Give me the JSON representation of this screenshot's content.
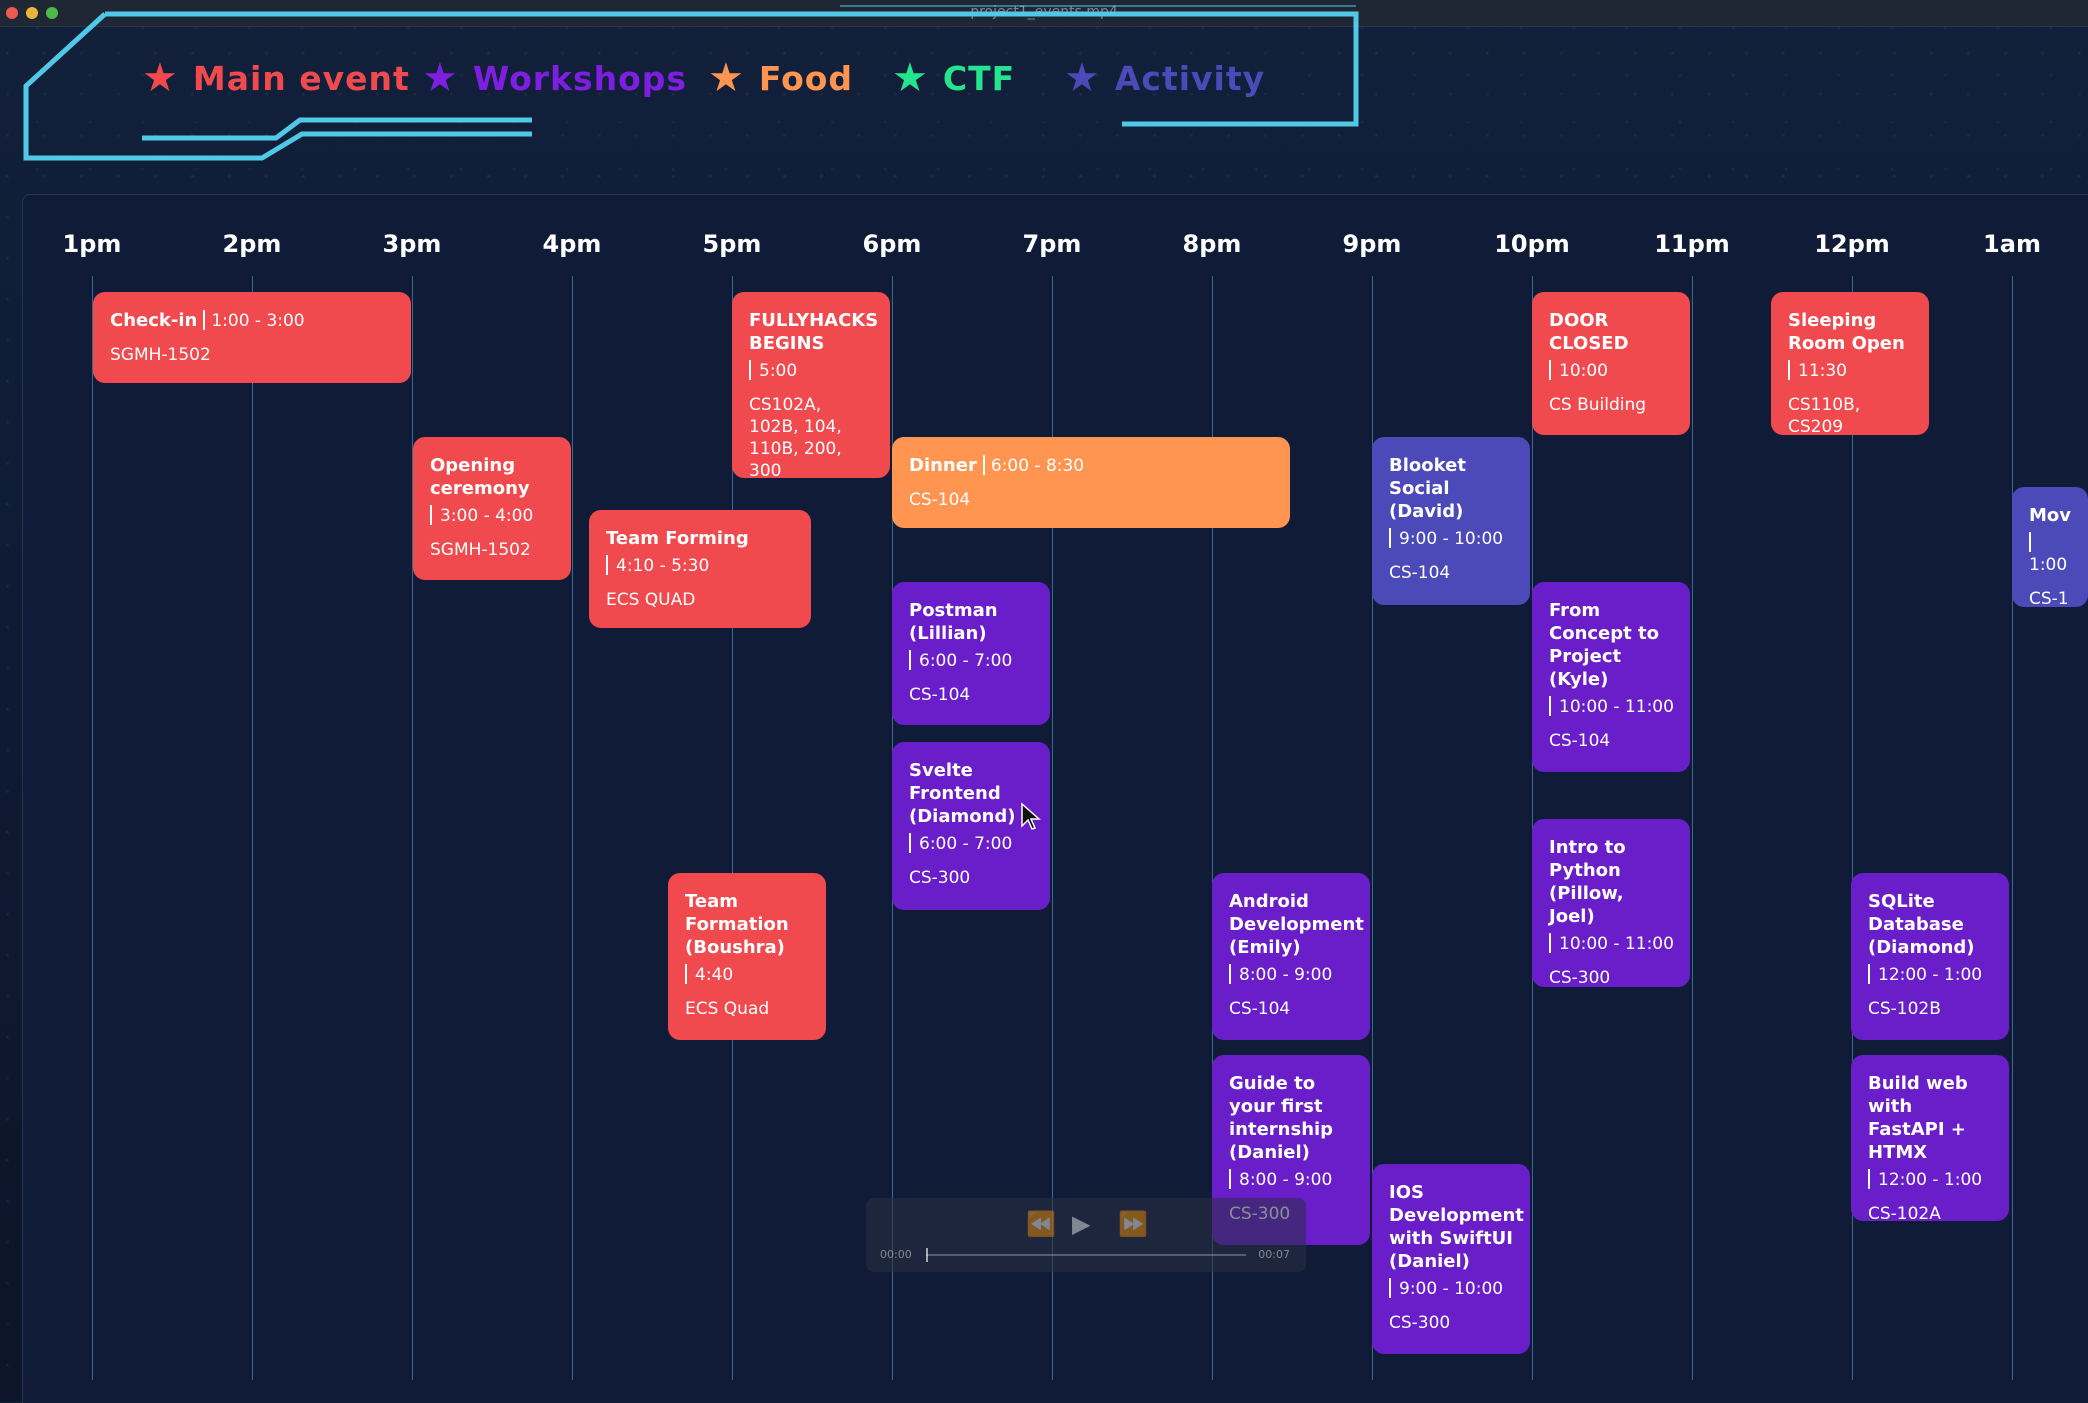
{
  "window": {
    "title": "project1_events.mp4"
  },
  "colors": {
    "main": "#f04a4e",
    "workshop": "#6a1ec9",
    "food": "#ff9550",
    "ctf": "#22e58e",
    "activity": "#4c49b8",
    "frame": "#4fc9e6"
  },
  "legend": [
    {
      "label": "Main event",
      "color": "#f04a4e",
      "icon": "star-icon"
    },
    {
      "label": "Workshops",
      "color": "#7d1ee0",
      "icon": "star-icon"
    },
    {
      "label": "Food",
      "color": "#ff9550",
      "icon": "star-icon"
    },
    {
      "label": "CTF",
      "color": "#22e58e",
      "icon": "star-icon"
    },
    {
      "label": "Activity",
      "color": "#4c49b8",
      "icon": "star-icon"
    }
  ],
  "hours": [
    "1pm",
    "2pm",
    "3pm",
    "4pm",
    "5pm",
    "6pm",
    "7pm",
    "8pm",
    "9pm",
    "10pm",
    "11pm",
    "12pm",
    "1am"
  ],
  "events": [
    {
      "category": "main",
      "title": "Check-in",
      "time": "1:00 - 3:00",
      "location": "SGMH-1502",
      "inline": true
    },
    {
      "category": "main",
      "title": "FULLYHACKS BEGINS",
      "time": "5:00",
      "location": "CS102A, 102B, 104, 110B, 200, 300"
    },
    {
      "category": "main",
      "title": "DOOR CLOSED",
      "time": "10:00",
      "location": "CS Building"
    },
    {
      "category": "main",
      "title": "Sleeping Room Open",
      "time": "11:30",
      "location": "CS110B, CS209"
    },
    {
      "category": "main",
      "title": "Opening ceremony",
      "time": "3:00 - 4:00",
      "location": "SGMH-1502"
    },
    {
      "category": "food",
      "title": "Dinner",
      "time": "6:00 - 8:30",
      "location": "CS-104",
      "inline": true
    },
    {
      "category": "activity",
      "title": "Blooket Social (David)",
      "time": "9:00 - 10:00",
      "location": "CS-104"
    },
    {
      "category": "main",
      "title": "Team Forming",
      "time": "4:10 - 5:30",
      "location": "ECS QUAD"
    },
    {
      "category": "activity",
      "title": "Mov",
      "time": "1:00",
      "location": "CS-1"
    },
    {
      "category": "workshop",
      "title": "Postman (Lillian)",
      "time": "6:00 - 7:00",
      "location": "CS-104"
    },
    {
      "category": "workshop",
      "title": "From Concept to Project (Kyle)",
      "time": "10:00 - 11:00",
      "location": "CS-104"
    },
    {
      "category": "workshop",
      "title": "Svelte Frontend (Diamond)",
      "time": "6:00 - 7:00",
      "location": "CS-300"
    },
    {
      "category": "workshop",
      "title": "Intro to Python (Pillow, Joel)",
      "time": "10:00 - 11:00",
      "location": "CS-300"
    },
    {
      "category": "main",
      "title": "Team Formation (Boushra)",
      "time": "4:40",
      "location": "ECS Quad"
    },
    {
      "category": "workshop",
      "title": "Android Development (Emily)",
      "time": "8:00 - 9:00",
      "location": "CS-104"
    },
    {
      "category": "workshop",
      "title": "SQLite Database (Diamond)",
      "time": "12:00 - 1:00",
      "location": "CS-102B"
    },
    {
      "category": "workshop",
      "title": "Guide to your first internship (Daniel)",
      "time": "8:00 - 9:00",
      "location": "CS-300"
    },
    {
      "category": "workshop",
      "title": "Build web with FastAPI + HTMX",
      "time": "12:00 - 1:00",
      "location": "CS-102A"
    },
    {
      "category": "workshop",
      "title": "IOS Development with SwiftUI (Daniel)",
      "time": "9:00 - 10:00",
      "location": "CS-300"
    }
  ],
  "player": {
    "elapsed": "00:00",
    "duration": "00:07",
    "progress": 0.0
  }
}
